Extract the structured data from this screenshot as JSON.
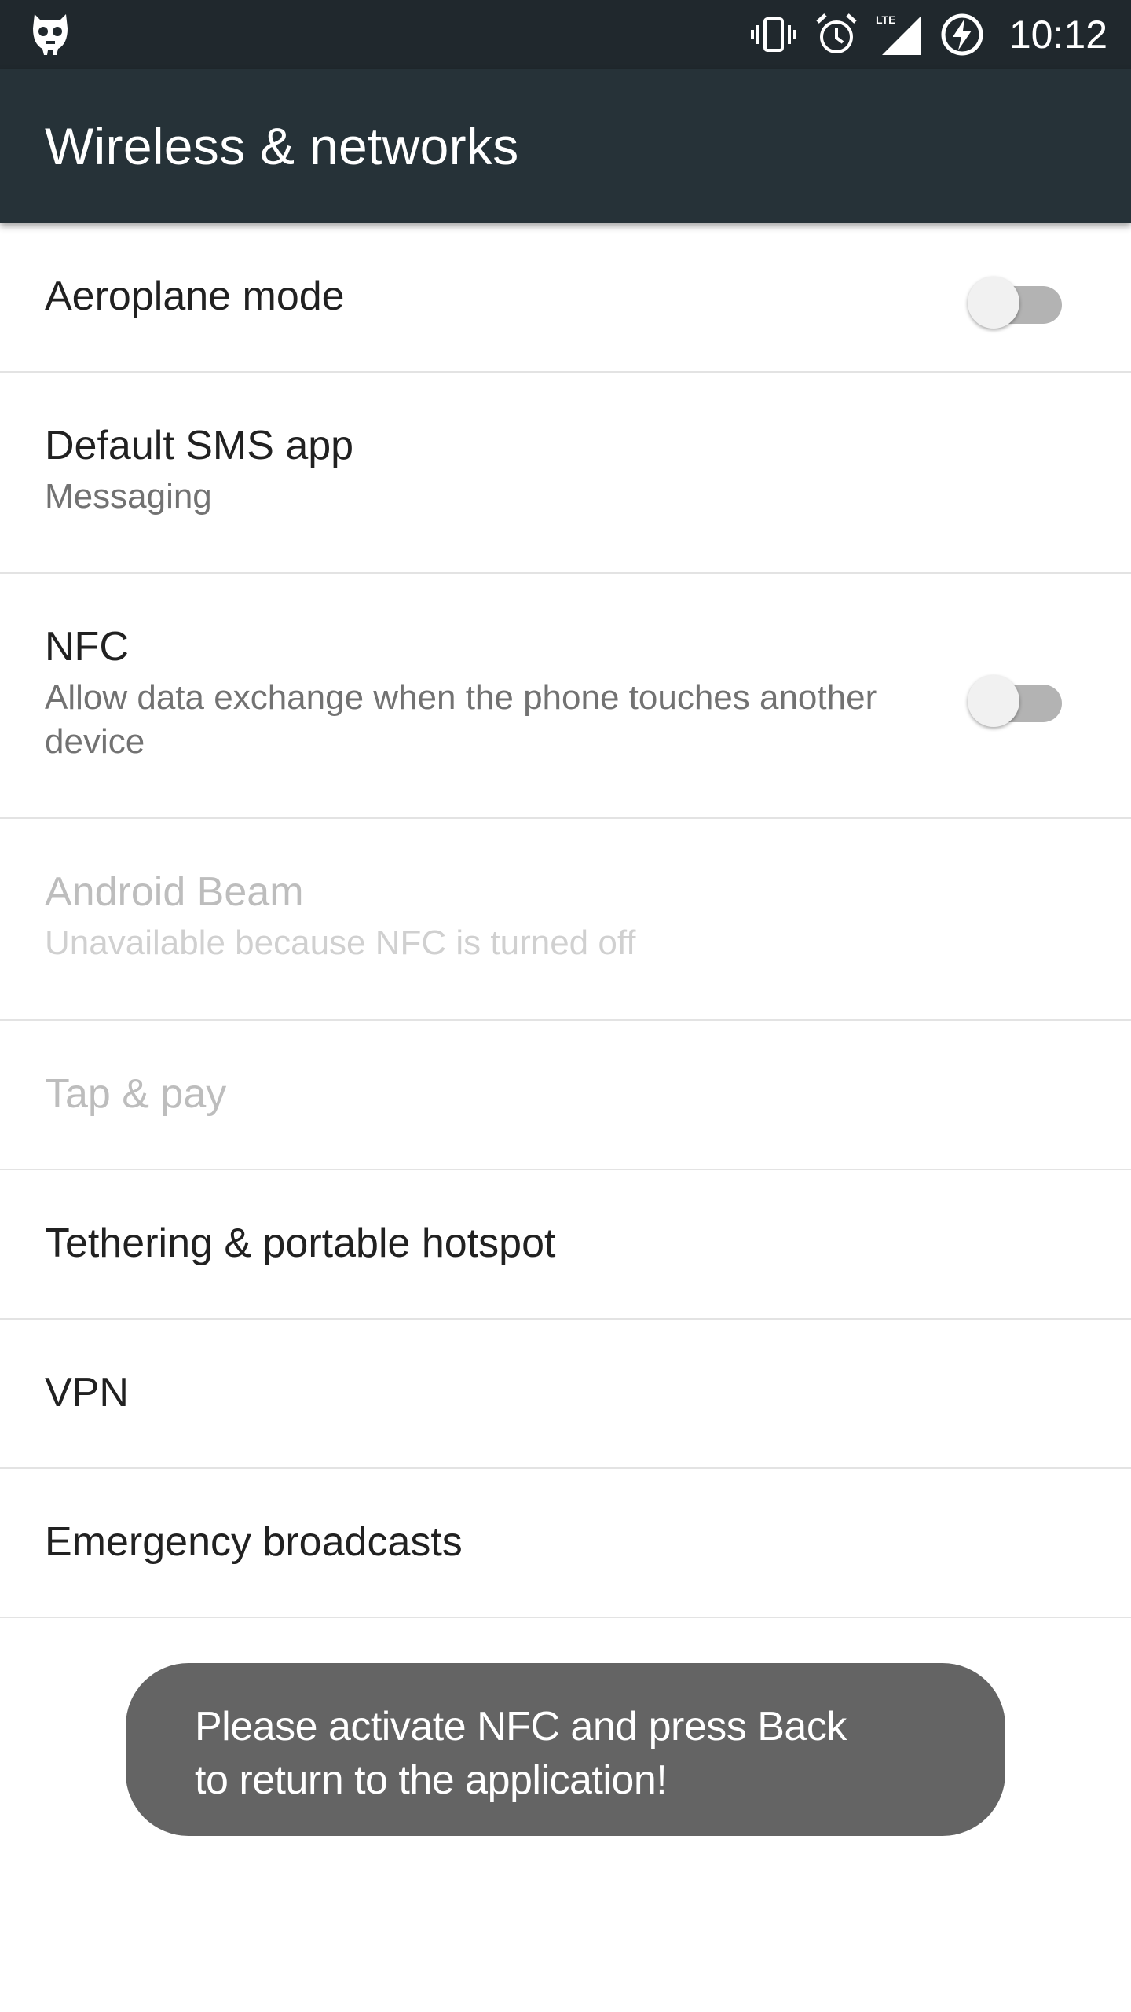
{
  "status_bar": {
    "left_icon": "cyanogen-mascot-icon",
    "icons": [
      "vibrate-icon",
      "alarm-icon",
      "lte-signal-icon",
      "battery-charging-icon"
    ],
    "lte_label": "LTE",
    "time": "10:12"
  },
  "app_bar": {
    "title": "Wireless & networks"
  },
  "settings": [
    {
      "title": "Aeroplane mode",
      "summary": "",
      "toggle": false,
      "enabled": true
    },
    {
      "title": "Default SMS app",
      "summary": "Messaging",
      "enabled": true
    },
    {
      "title": "NFC",
      "summary": "Allow data exchange when the phone touches another device",
      "toggle": false,
      "enabled": true
    },
    {
      "title": "Android Beam",
      "summary": "Unavailable because NFC is turned off",
      "enabled": false
    },
    {
      "title": "Tap & pay",
      "summary": "",
      "enabled": false
    },
    {
      "title": "Tethering & portable hotspot",
      "summary": "",
      "enabled": true
    },
    {
      "title": "VPN",
      "summary": "",
      "enabled": true
    },
    {
      "title": "Emergency broadcasts",
      "summary": "",
      "enabled": true
    }
  ],
  "toast": {
    "message": "Please activate NFC and press Back to return to the application!"
  },
  "colors": {
    "status_bar": "#20282d",
    "app_bar": "#263238",
    "toast": "#646464"
  }
}
